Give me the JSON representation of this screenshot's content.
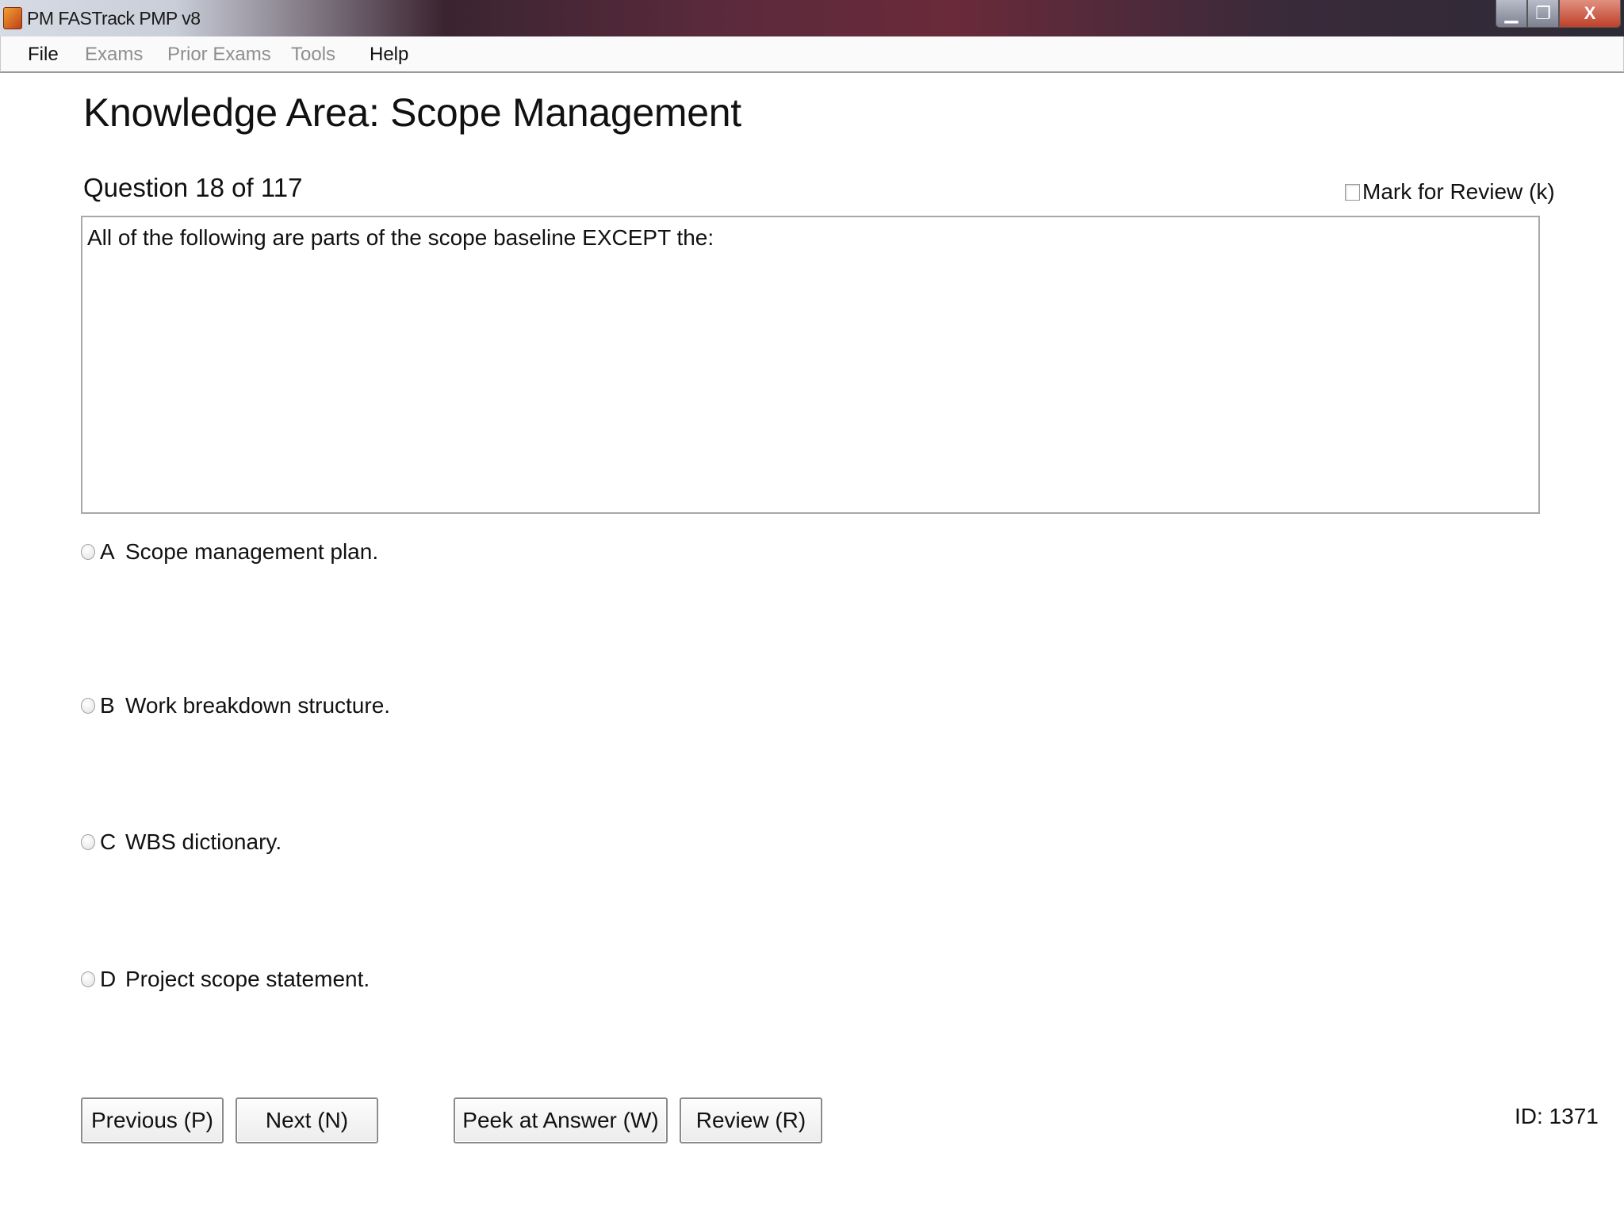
{
  "window": {
    "title": "PM FASTrack PMP v8",
    "controls": {
      "minimize": "▁",
      "maximize": "❐",
      "close": "X"
    }
  },
  "menu": {
    "items": [
      {
        "label": "File",
        "enabled": true
      },
      {
        "label": "Exams",
        "enabled": false
      },
      {
        "label": "Prior Exams",
        "enabled": false
      },
      {
        "label": "Tools",
        "enabled": false
      },
      {
        "label": "Help",
        "enabled": true
      }
    ]
  },
  "page": {
    "knowledge_area": "Knowledge Area: Scope Management",
    "question_counter": "Question 18 of 117",
    "mark_for_review": {
      "label": "Mark for Review (k)",
      "checked": false
    },
    "question_text": "All of the following are parts of the scope baseline EXCEPT the:",
    "options": [
      {
        "letter": "A",
        "text": "Scope management plan.",
        "selected": false
      },
      {
        "letter": "B",
        "text": "Work breakdown structure.",
        "selected": false
      },
      {
        "letter": "C",
        "text": "WBS dictionary.",
        "selected": false
      },
      {
        "letter": "D",
        "text": "Project scope statement.",
        "selected": false
      }
    ],
    "id_label": "ID: 1371"
  },
  "buttons": {
    "previous": "Previous (P)",
    "next": "Next (N)",
    "peek": "Peek at Answer (W)",
    "review": "Review (R)"
  },
  "colors": {
    "disabled_menu_text": "#8e8e8e",
    "border": "#a8a8a8"
  },
  "icons": {
    "app": "fastrack-app-icon",
    "minimize": "minimize-icon",
    "maximize": "maximize-icon",
    "close": "close-icon"
  }
}
